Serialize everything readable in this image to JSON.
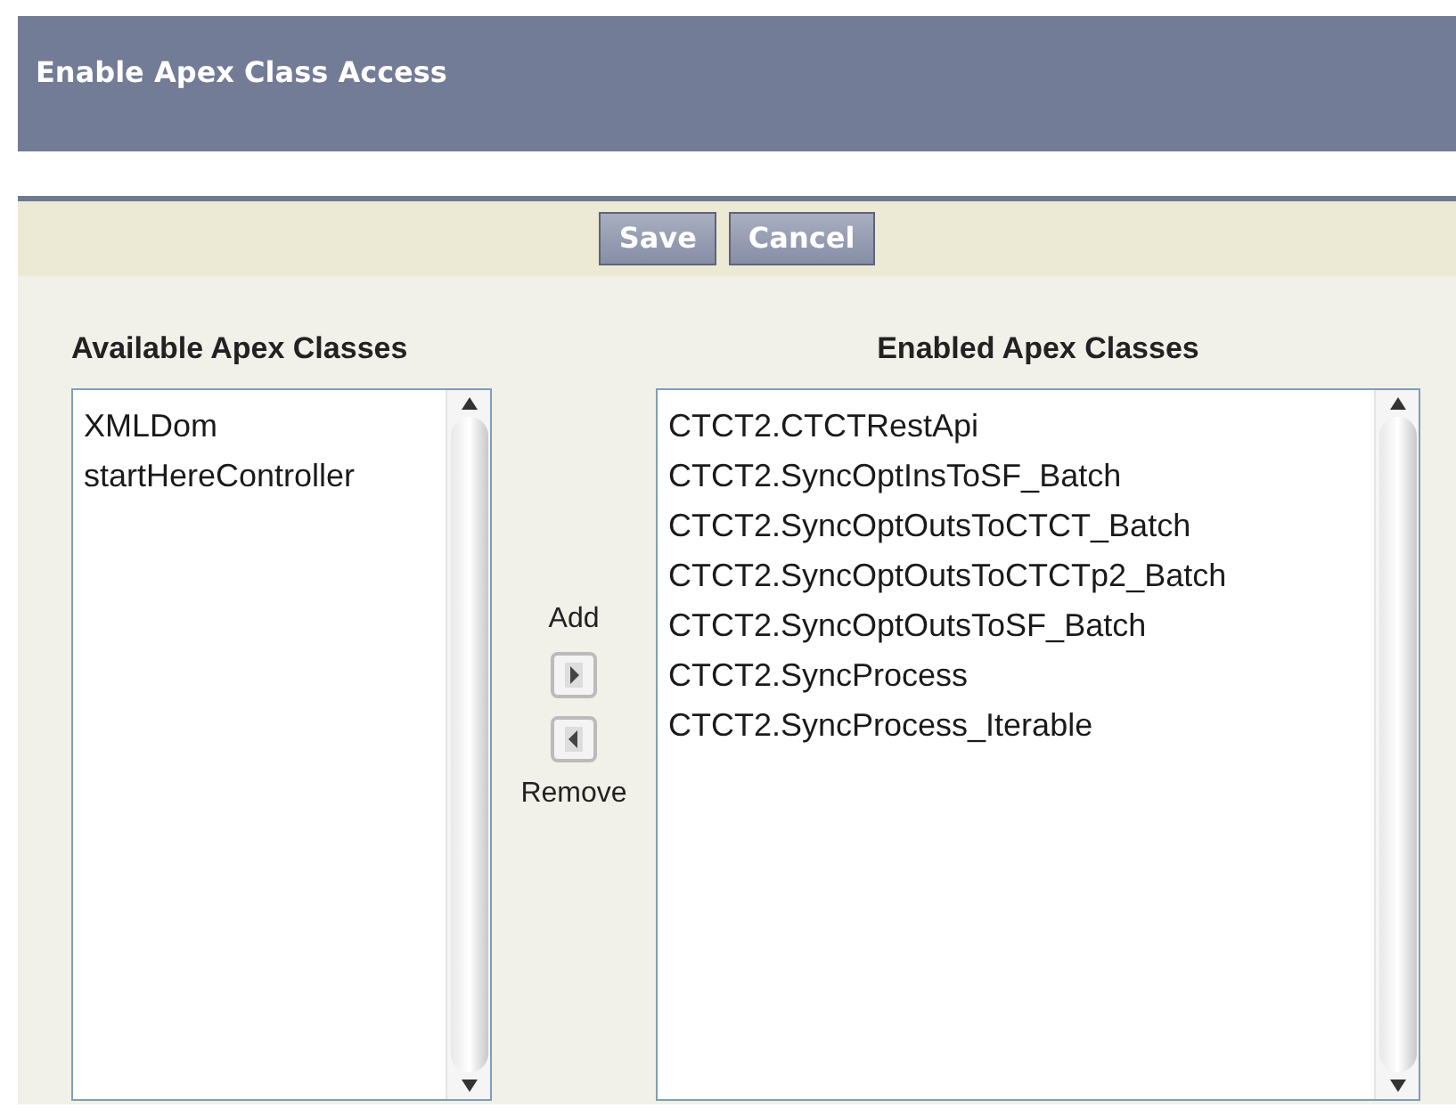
{
  "header": {
    "title": "Enable Apex Class Access"
  },
  "buttons": [
    {
      "label": "Save"
    },
    {
      "label": "Cancel"
    }
  ],
  "available": {
    "heading": "Available Apex Classes",
    "items": [
      "XMLDom",
      "startHereController"
    ]
  },
  "mover": {
    "add_label": "Add",
    "remove_label": "Remove"
  },
  "enabled": {
    "heading": "Enabled Apex Classes",
    "items": [
      "CTCT2.CTCTRestApi",
      "CTCT2.SyncOptInsToSF_Batch",
      "CTCT2.SyncOptOutsToCTCT_Batch",
      "CTCT2.SyncOptOutsToCTCTp2_Batch",
      "CTCT2.SyncOptOutsToSF_Batch",
      "CTCT2.SyncProcess",
      "CTCT2.SyncProcess_Iterable"
    ]
  }
}
